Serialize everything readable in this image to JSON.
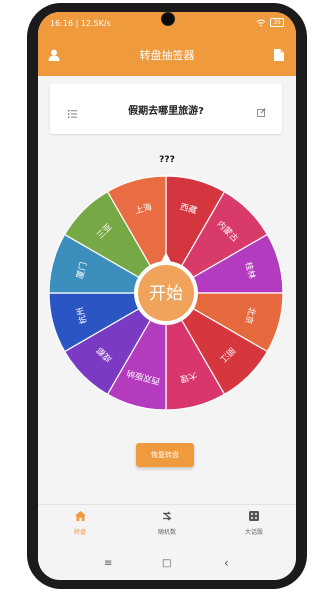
{
  "status_bar": {
    "time_text": "16:16 | 12.5K/s",
    "battery": "35"
  },
  "app_bar": {
    "title": "转盘抽签器",
    "left_icon": "person-icon",
    "right_icon": "document-icon"
  },
  "topic": {
    "question": "假期去哪里旅游?",
    "left_icon": "list-icon",
    "right_icon": "edit-icon"
  },
  "result_text": "???",
  "wheel": {
    "center_label": "开始",
    "segments": [
      {
        "label": "西藏",
        "color": "#d4363f"
      },
      {
        "label": "内蒙古",
        "color": "#d83a6a"
      },
      {
        "label": "桂林",
        "color": "#b33bbf"
      },
      {
        "label": "北京",
        "color": "#e6693e"
      },
      {
        "label": "丽江",
        "color": "#d6373e"
      },
      {
        "label": "大理",
        "color": "#d8366c"
      },
      {
        "label": "西双版纳",
        "color": "#b33bbd"
      },
      {
        "label": "成都",
        "color": "#7b3ac4"
      },
      {
        "label": "杭州",
        "color": "#2c55c4"
      },
      {
        "label": "厦门",
        "color": "#3c8ebc"
      },
      {
        "label": "三亚",
        "color": "#76a946"
      },
      {
        "label": "上海",
        "color": "#e96d42"
      }
    ]
  },
  "restore_button": "恢复转盘",
  "tabs": [
    {
      "label": "转盘",
      "icon": "home-icon",
      "active": true
    },
    {
      "label": "随机数",
      "icon": "shuffle-icon",
      "active": false
    },
    {
      "label": "大话骰",
      "icon": "dice-icon",
      "active": false
    }
  ],
  "nav": {
    "menu": "≡",
    "home": "□",
    "back": "‹"
  }
}
